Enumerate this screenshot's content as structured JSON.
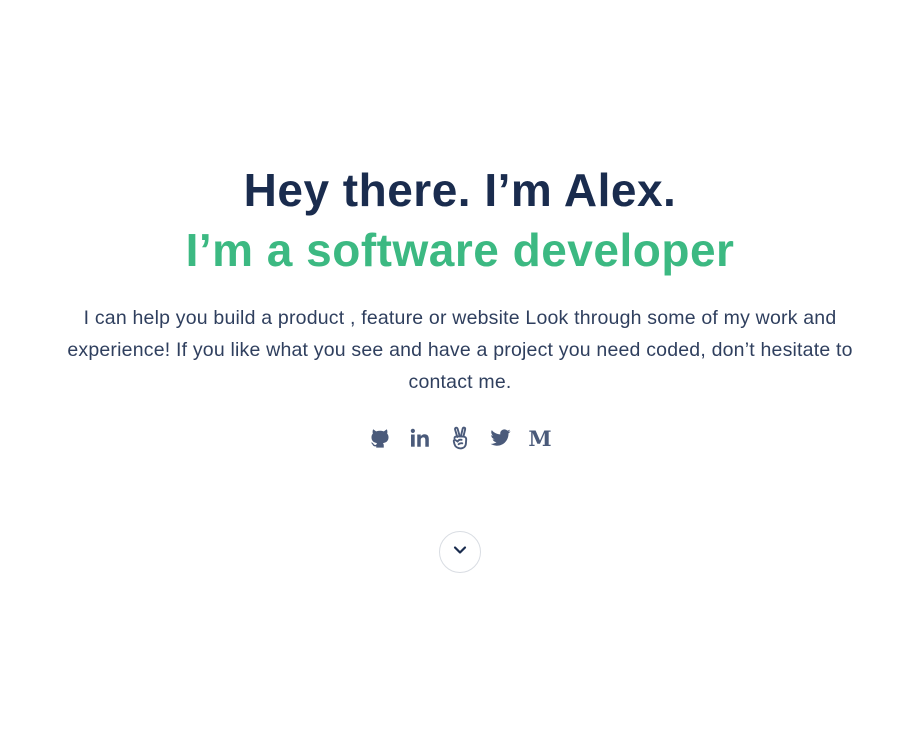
{
  "hero": {
    "greeting": "Hey there. I’m Alex.",
    "role": "I’m a software developer",
    "intro": "I can help you build a product , feature or website Look through some of my work and experience! If you like what you see and have a project you need coded, don’t hesitate to contact me."
  },
  "social": [
    {
      "name": "GitHub",
      "icon": "github-icon"
    },
    {
      "name": "LinkedIn",
      "icon": "linkedin-icon"
    },
    {
      "name": "AngelList",
      "icon": "angellist-icon"
    },
    {
      "name": "Twitter",
      "icon": "twitter-icon"
    },
    {
      "name": "Medium",
      "icon": "medium-icon",
      "glyph": "M"
    }
  ],
  "scroll": {
    "icon": "chevron-down-icon"
  },
  "colors": {
    "heading": "#1a2c4e",
    "accent": "#3cb982",
    "body_text": "#2f3f5e",
    "icon": "#4a5a7a"
  }
}
